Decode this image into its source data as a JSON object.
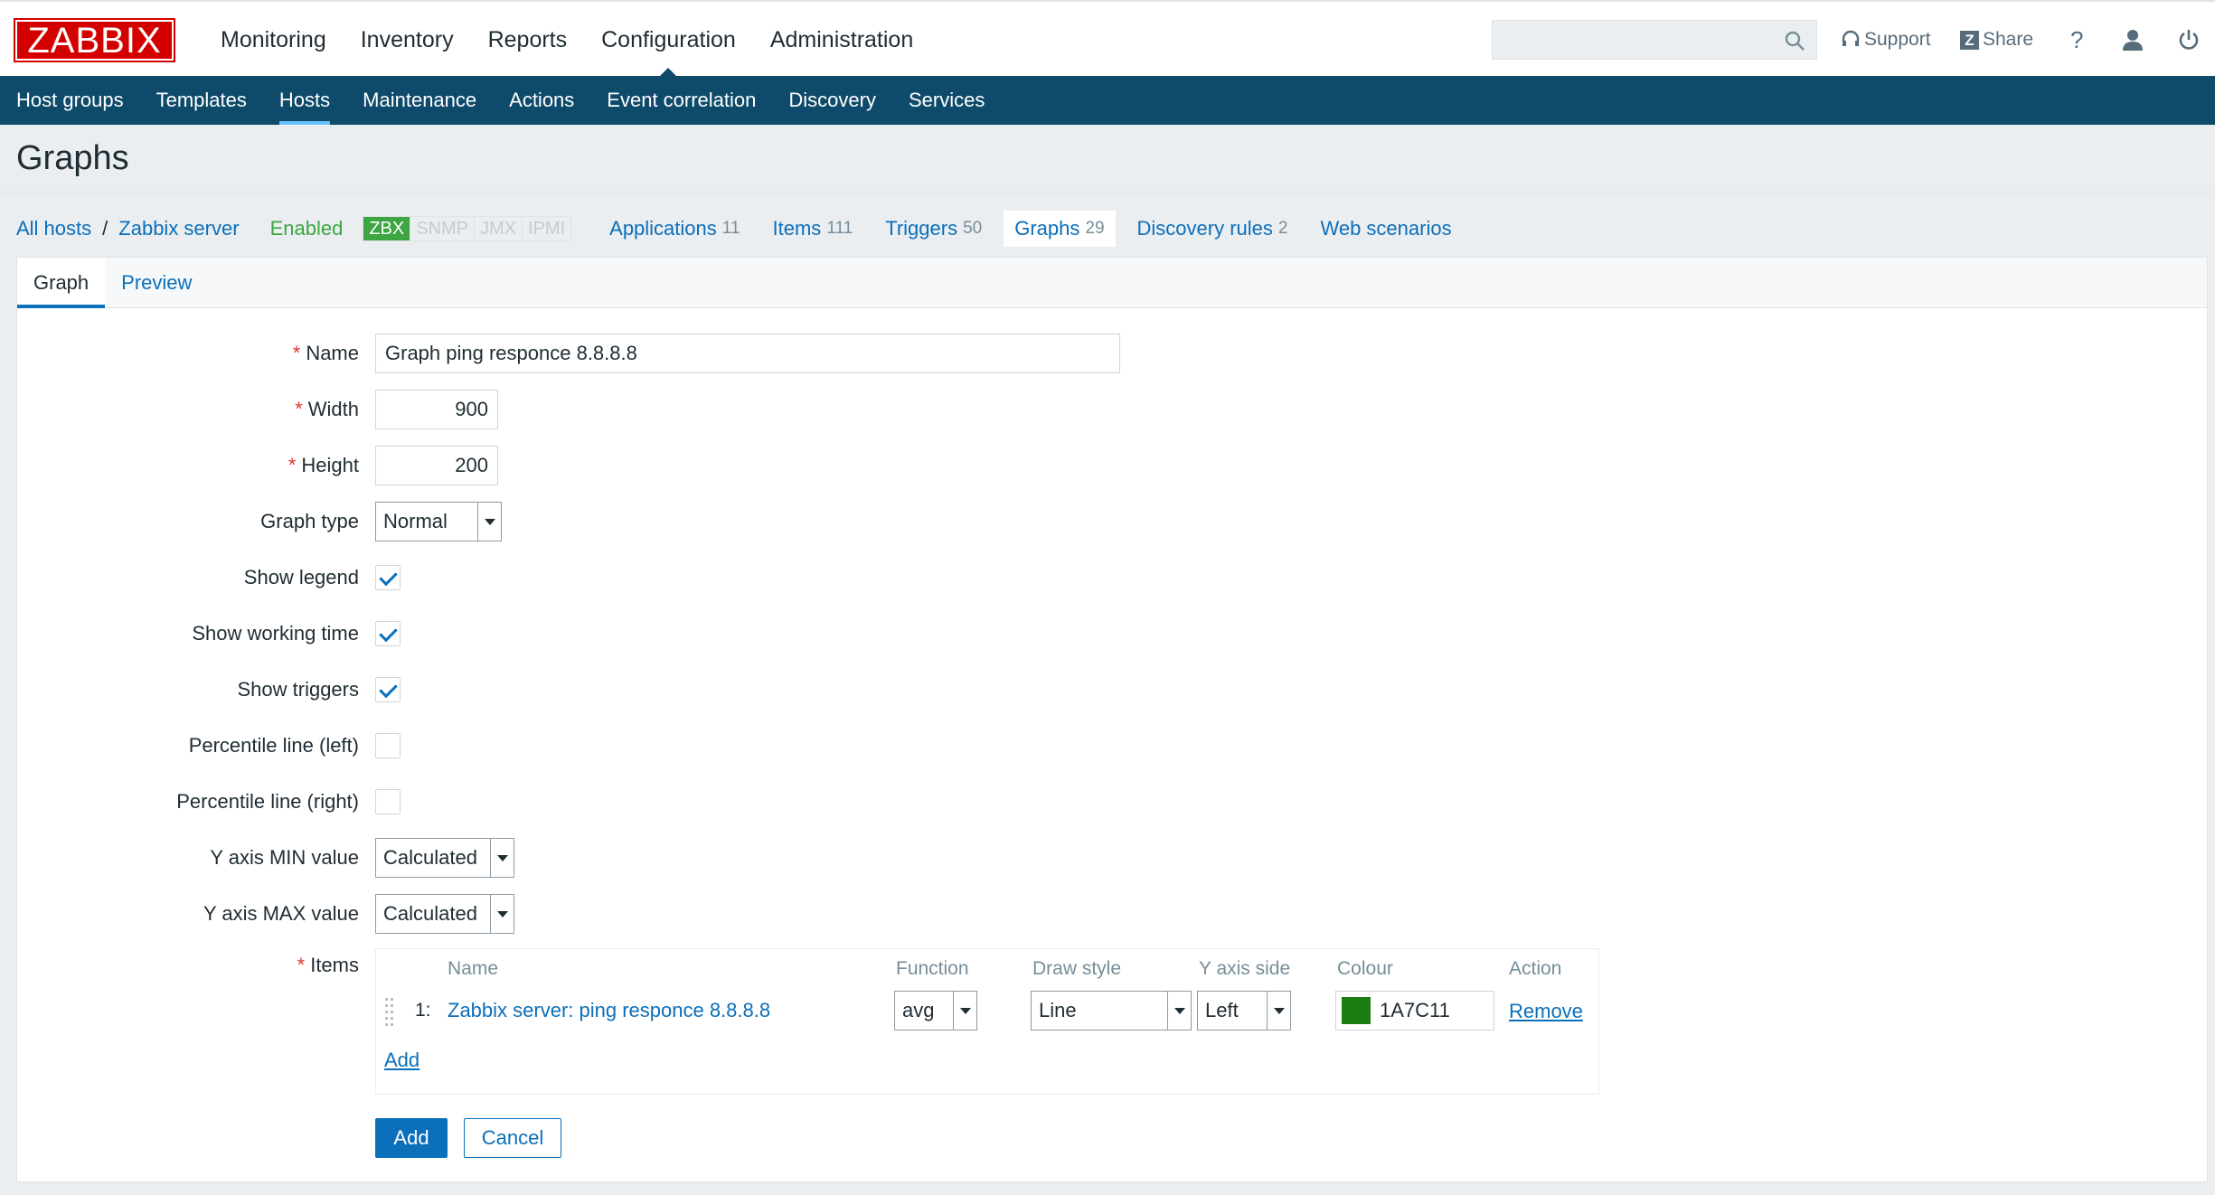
{
  "brand": {
    "logo": "ZABBIX",
    "color": "#D40000"
  },
  "main_menu": [
    {
      "label": "Monitoring"
    },
    {
      "label": "Inventory"
    },
    {
      "label": "Reports"
    },
    {
      "label": "Configuration",
      "active": true
    },
    {
      "label": "Administration"
    }
  ],
  "toolbar": {
    "search_placeholder": "",
    "support_label": "Support",
    "share_label": "Share",
    "share_badge": "Z",
    "help_label": "?"
  },
  "sub_menu": [
    {
      "label": "Host groups"
    },
    {
      "label": "Templates"
    },
    {
      "label": "Hosts",
      "active": true
    },
    {
      "label": "Maintenance"
    },
    {
      "label": "Actions"
    },
    {
      "label": "Event correlation"
    },
    {
      "label": "Discovery"
    },
    {
      "label": "Services"
    }
  ],
  "page": {
    "title": "Graphs"
  },
  "host_nav": {
    "all_hosts": "All hosts",
    "separator": "/",
    "host": "Zabbix server",
    "status": "Enabled",
    "availability": [
      "ZBX",
      "SNMP",
      "JMX",
      "IPMI"
    ],
    "links": [
      {
        "label": "Applications",
        "count": "11"
      },
      {
        "label": "Items",
        "count": "111"
      },
      {
        "label": "Triggers",
        "count": "50"
      },
      {
        "label": "Graphs",
        "count": "29",
        "active": true
      },
      {
        "label": "Discovery rules",
        "count": "2"
      },
      {
        "label": "Web scenarios",
        "count": ""
      }
    ]
  },
  "tabs": [
    {
      "label": "Graph",
      "active": true
    },
    {
      "label": "Preview"
    }
  ],
  "form": {
    "name": {
      "label": "Name",
      "value": "Graph ping responce 8.8.8.8"
    },
    "width": {
      "label": "Width",
      "value": "900"
    },
    "height": {
      "label": "Height",
      "value": "200"
    },
    "graph_type": {
      "label": "Graph type",
      "value": "Normal"
    },
    "show_legend": {
      "label": "Show legend",
      "checked": true
    },
    "show_working_time": {
      "label": "Show working time",
      "checked": true
    },
    "show_triggers": {
      "label": "Show triggers",
      "checked": true
    },
    "percentile_left": {
      "label": "Percentile line (left)",
      "checked": false
    },
    "percentile_right": {
      "label": "Percentile line (right)",
      "checked": false
    },
    "y_min": {
      "label": "Y axis MIN value",
      "value": "Calculated"
    },
    "y_max": {
      "label": "Y axis MAX value",
      "value": "Calculated"
    },
    "items_label": "Items",
    "required_mark": "*"
  },
  "items_table": {
    "headers": [
      "Name",
      "Function",
      "Draw style",
      "Y axis side",
      "Colour",
      "Action"
    ],
    "rows": [
      {
        "index": "1:",
        "name": "Zabbix server: ping responce 8.8.8.8",
        "function": "avg",
        "draw_style": "Line",
        "y_axis_side": "Left",
        "colour": "1A7C11",
        "action": "Remove"
      }
    ],
    "add_label": "Add"
  },
  "buttons": {
    "add": "Add",
    "cancel": "Cancel"
  }
}
